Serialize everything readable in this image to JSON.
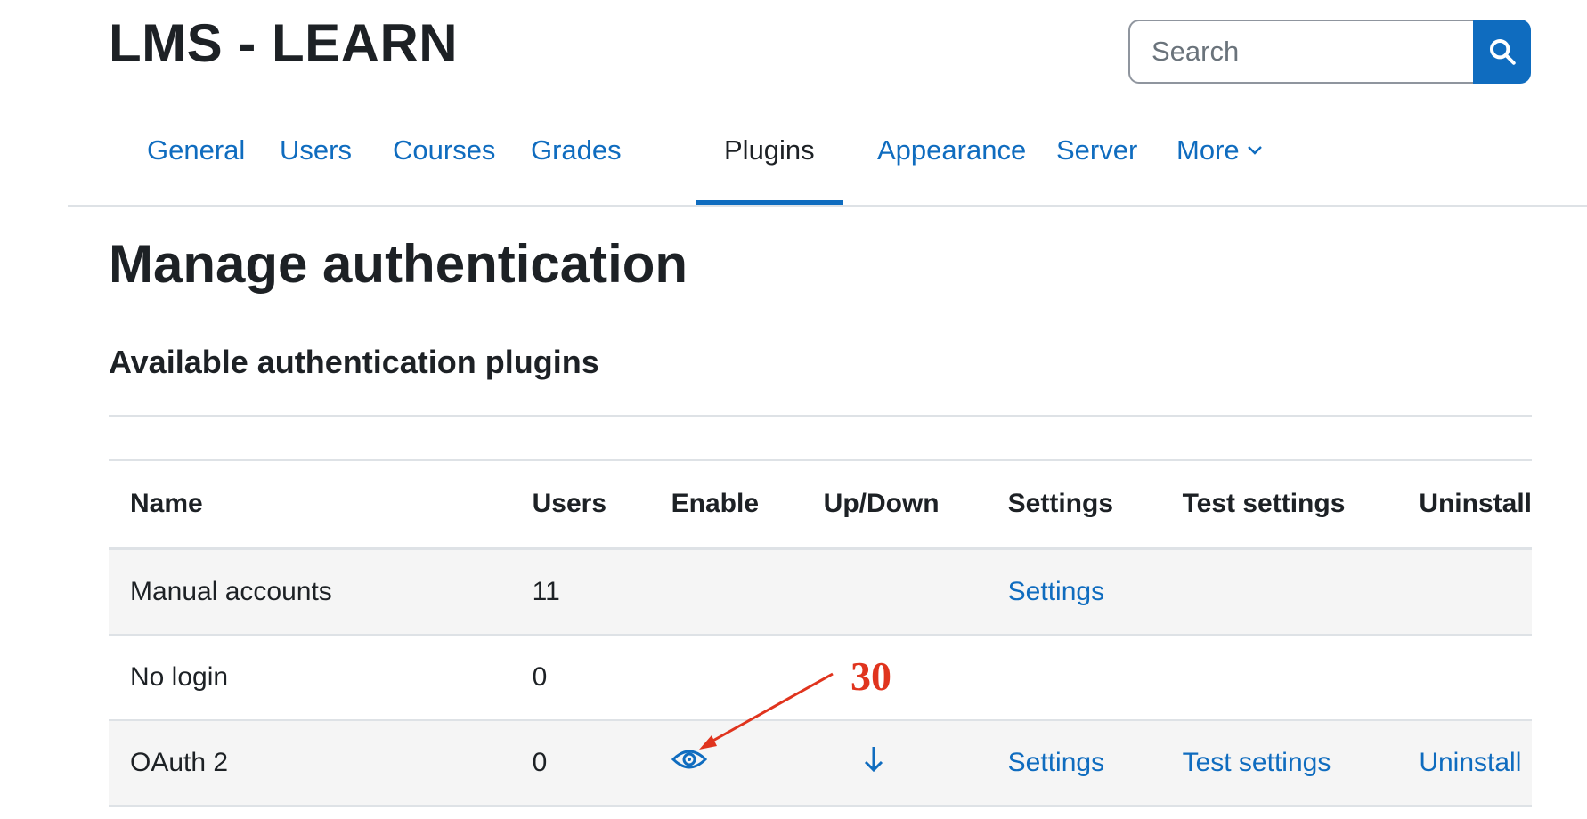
{
  "site": {
    "title": "LMS - LEARN"
  },
  "search": {
    "placeholder": "Search"
  },
  "nav": {
    "tabs": [
      {
        "label": "General"
      },
      {
        "label": "Users"
      },
      {
        "label": "Courses"
      },
      {
        "label": "Grades"
      },
      {
        "label": "Plugins",
        "active": true
      },
      {
        "label": "Appearance"
      },
      {
        "label": "Server"
      },
      {
        "label": "More"
      }
    ]
  },
  "page": {
    "title": "Manage authentication",
    "section_title": "Available authentication plugins"
  },
  "table": {
    "headers": [
      "Name",
      "Users",
      "Enable",
      "Up/Down",
      "Settings",
      "Test settings",
      "Uninstall"
    ],
    "rows": [
      {
        "name": "Manual accounts",
        "users": "11",
        "settings": "Settings",
        "test_settings": "",
        "uninstall": ""
      },
      {
        "name": "No login",
        "users": "0",
        "settings": "",
        "test_settings": "",
        "uninstall": ""
      },
      {
        "name": "OAuth 2",
        "users": "0",
        "enable_icon": "eye-icon",
        "updown_icon": "arrow-down-icon",
        "settings": "Settings",
        "test_settings": "Test settings",
        "uninstall": "Uninstall"
      }
    ]
  },
  "annotation": {
    "number": "30",
    "color": "#e0341e"
  },
  "colors": {
    "accent": "#0f6cbf",
    "text": "#1d2125",
    "border": "#dee2e6",
    "stripe": "#f5f5f5"
  }
}
